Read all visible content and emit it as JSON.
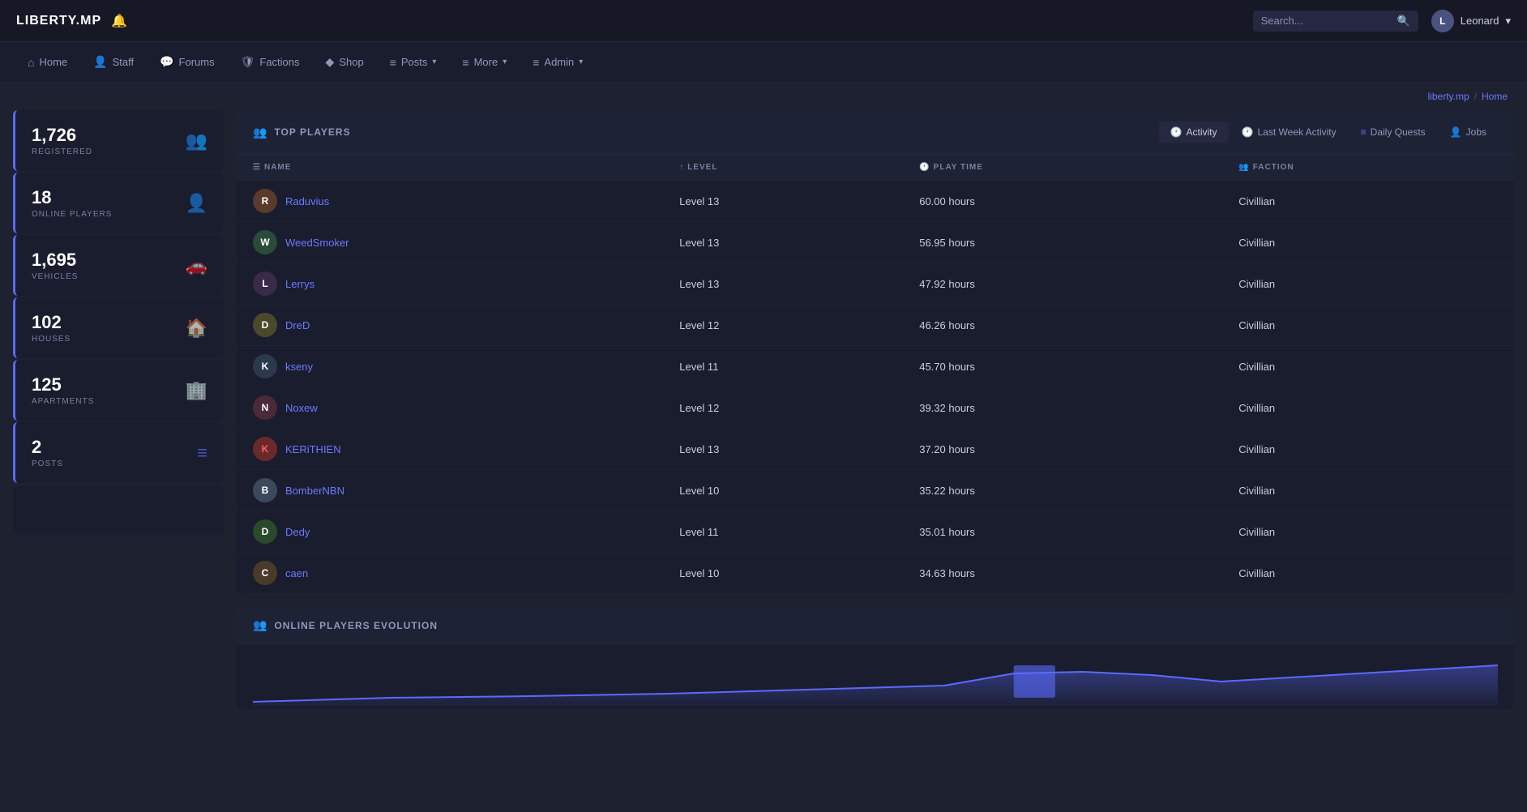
{
  "brand": {
    "name": "LIBERTY.MP"
  },
  "navbar": {
    "search_placeholder": "Search...",
    "user_name": "Leonard",
    "user_initial": "L",
    "bell_icon": "🔔"
  },
  "nav_menu": {
    "items": [
      {
        "id": "home",
        "label": "Home",
        "icon": "⌂",
        "dropdown": false
      },
      {
        "id": "staff",
        "label": "Staff",
        "icon": "👤",
        "dropdown": false
      },
      {
        "id": "forums",
        "label": "Forums",
        "icon": "💬",
        "dropdown": false
      },
      {
        "id": "factions",
        "label": "Factions",
        "icon": "🛡",
        "dropdown": false
      },
      {
        "id": "shop",
        "label": "Shop",
        "icon": "◆",
        "dropdown": false
      },
      {
        "id": "posts",
        "label": "Posts",
        "icon": "≡",
        "dropdown": true
      },
      {
        "id": "more",
        "label": "More",
        "icon": "≡",
        "dropdown": true
      },
      {
        "id": "admin",
        "label": "Admin",
        "icon": "≡",
        "dropdown": true
      }
    ]
  },
  "breadcrumb": {
    "site": "liberty.mp",
    "separator": "/",
    "current": "Home"
  },
  "stats": [
    {
      "id": "registered",
      "number": "1,726",
      "label": "REGISTERED",
      "icon": "👥"
    },
    {
      "id": "online",
      "number": "18",
      "label": "ONLINE PLAYERS",
      "icon": "👤"
    },
    {
      "id": "vehicles",
      "number": "1,695",
      "label": "VEHICLES",
      "icon": "🚗"
    },
    {
      "id": "houses",
      "number": "102",
      "label": "HOUSES",
      "icon": "🏠"
    },
    {
      "id": "apartments",
      "number": "125",
      "label": "APARTMENTS",
      "icon": "🏢"
    },
    {
      "id": "posts",
      "number": "2",
      "label": "POSTS",
      "icon": "≡"
    }
  ],
  "top_players": {
    "section_title": "TOP PLAYERS",
    "section_icon": "👥",
    "tabs": [
      {
        "id": "activity",
        "label": "Activity",
        "icon": "🕐",
        "active": true
      },
      {
        "id": "last_week",
        "label": "Last Week Activity",
        "icon": "🕐",
        "active": false
      },
      {
        "id": "daily_quests",
        "label": "Daily Quests",
        "icon": "≡",
        "active": false
      },
      {
        "id": "jobs",
        "label": "Jobs",
        "icon": "👤",
        "active": false
      }
    ],
    "columns": [
      {
        "id": "name",
        "label": "NAME",
        "icon": "☰"
      },
      {
        "id": "level",
        "label": "LEVEL",
        "icon": "↑"
      },
      {
        "id": "play_time",
        "label": "PLAY TIME",
        "icon": "🕐"
      },
      {
        "id": "faction",
        "label": "FACTION",
        "icon": "👥"
      }
    ],
    "players": [
      {
        "name": "Raduvius",
        "level": "Level 13",
        "play_time": "60.00 hours",
        "faction": "Civillian",
        "av_class": "av-raduvius",
        "initial": "R"
      },
      {
        "name": "WeedSmoker",
        "level": "Level 13",
        "play_time": "56.95 hours",
        "faction": "Civillian",
        "av_class": "av-weedsmoker",
        "initial": "W"
      },
      {
        "name": "Lerrys",
        "level": "Level 13",
        "play_time": "47.92 hours",
        "faction": "Civillian",
        "av_class": "av-lerrys",
        "initial": "L"
      },
      {
        "name": "DreD",
        "level": "Level 12",
        "play_time": "46.26 hours",
        "faction": "Civillian",
        "av_class": "av-dred",
        "initial": "D"
      },
      {
        "name": "kseny",
        "level": "Level 11",
        "play_time": "45.70 hours",
        "faction": "Civillian",
        "av_class": "av-kseny",
        "initial": "K"
      },
      {
        "name": "Noxew",
        "level": "Level 12",
        "play_time": "39.32 hours",
        "faction": "Civillian",
        "av_class": "av-noxew",
        "initial": "N"
      },
      {
        "name": "KERiTHIEN",
        "level": "Level 13",
        "play_time": "37.20 hours",
        "faction": "Civillian",
        "av_class": "av-kerithien",
        "initial": "K"
      },
      {
        "name": "BomberNBN",
        "level": "Level 10",
        "play_time": "35.22 hours",
        "faction": "Civillian",
        "av_class": "av-bombernbn",
        "initial": "B"
      },
      {
        "name": "Dedy",
        "level": "Level 11",
        "play_time": "35.01 hours",
        "faction": "Civillian",
        "av_class": "av-dedy",
        "initial": "D"
      },
      {
        "name": "caen",
        "level": "Level 10",
        "play_time": "34.63 hours",
        "faction": "Civillian",
        "av_class": "av-caen",
        "initial": "C"
      }
    ]
  },
  "evolution": {
    "section_title": "ONLINE PLAYERS EVOLUTION",
    "section_icon": "👥"
  }
}
